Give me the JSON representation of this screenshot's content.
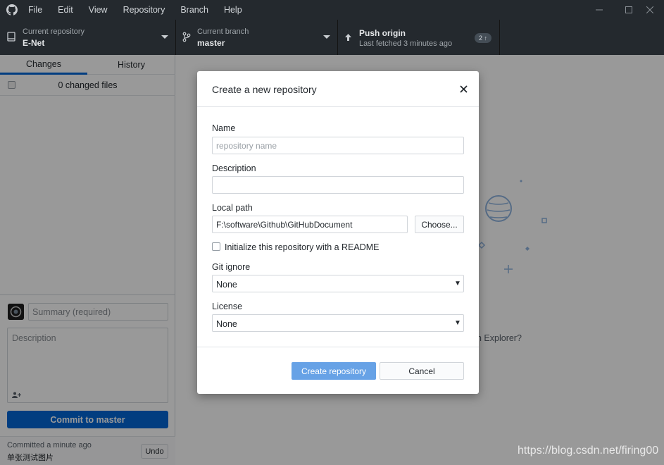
{
  "menu": [
    "File",
    "Edit",
    "View",
    "Repository",
    "Branch",
    "Help"
  ],
  "toolbar": {
    "repo_label": "Current repository",
    "repo_value": "E-Net",
    "branch_label": "Current branch",
    "branch_value": "master",
    "push_label": "Push origin",
    "push_sub": "Last fetched 3 minutes ago",
    "push_badge": "2 ↑"
  },
  "sidebar": {
    "tabs": [
      "Changes",
      "History"
    ],
    "changed_files": "0 changed files",
    "summary_placeholder": "Summary (required)",
    "description_placeholder": "Description",
    "commit_button": "Commit to master",
    "last_commit_time": "Committed a minute ago",
    "last_commit_message": "单张测试图片",
    "undo": "Undo"
  },
  "main": {
    "hint_partial": "n Explorer?"
  },
  "dialog": {
    "title": "Create a new repository",
    "name_label": "Name",
    "name_placeholder": "repository name",
    "description_label": "Description",
    "local_path_label": "Local path",
    "local_path_value": "F:\\software\\Github\\GitHubDocument",
    "choose_button": "Choose...",
    "readme_label": "Initialize this repository with a README",
    "gitignore_label": "Git ignore",
    "gitignore_value": "None",
    "license_label": "License",
    "license_value": "None",
    "create_button": "Create repository",
    "cancel_button": "Cancel"
  },
  "watermark": "https://blog.csdn.net/firing00",
  "colors": {
    "titlebar": "#24292e",
    "accent": "#0366d6",
    "overlay": "rgba(0,0,0,0.40)"
  }
}
